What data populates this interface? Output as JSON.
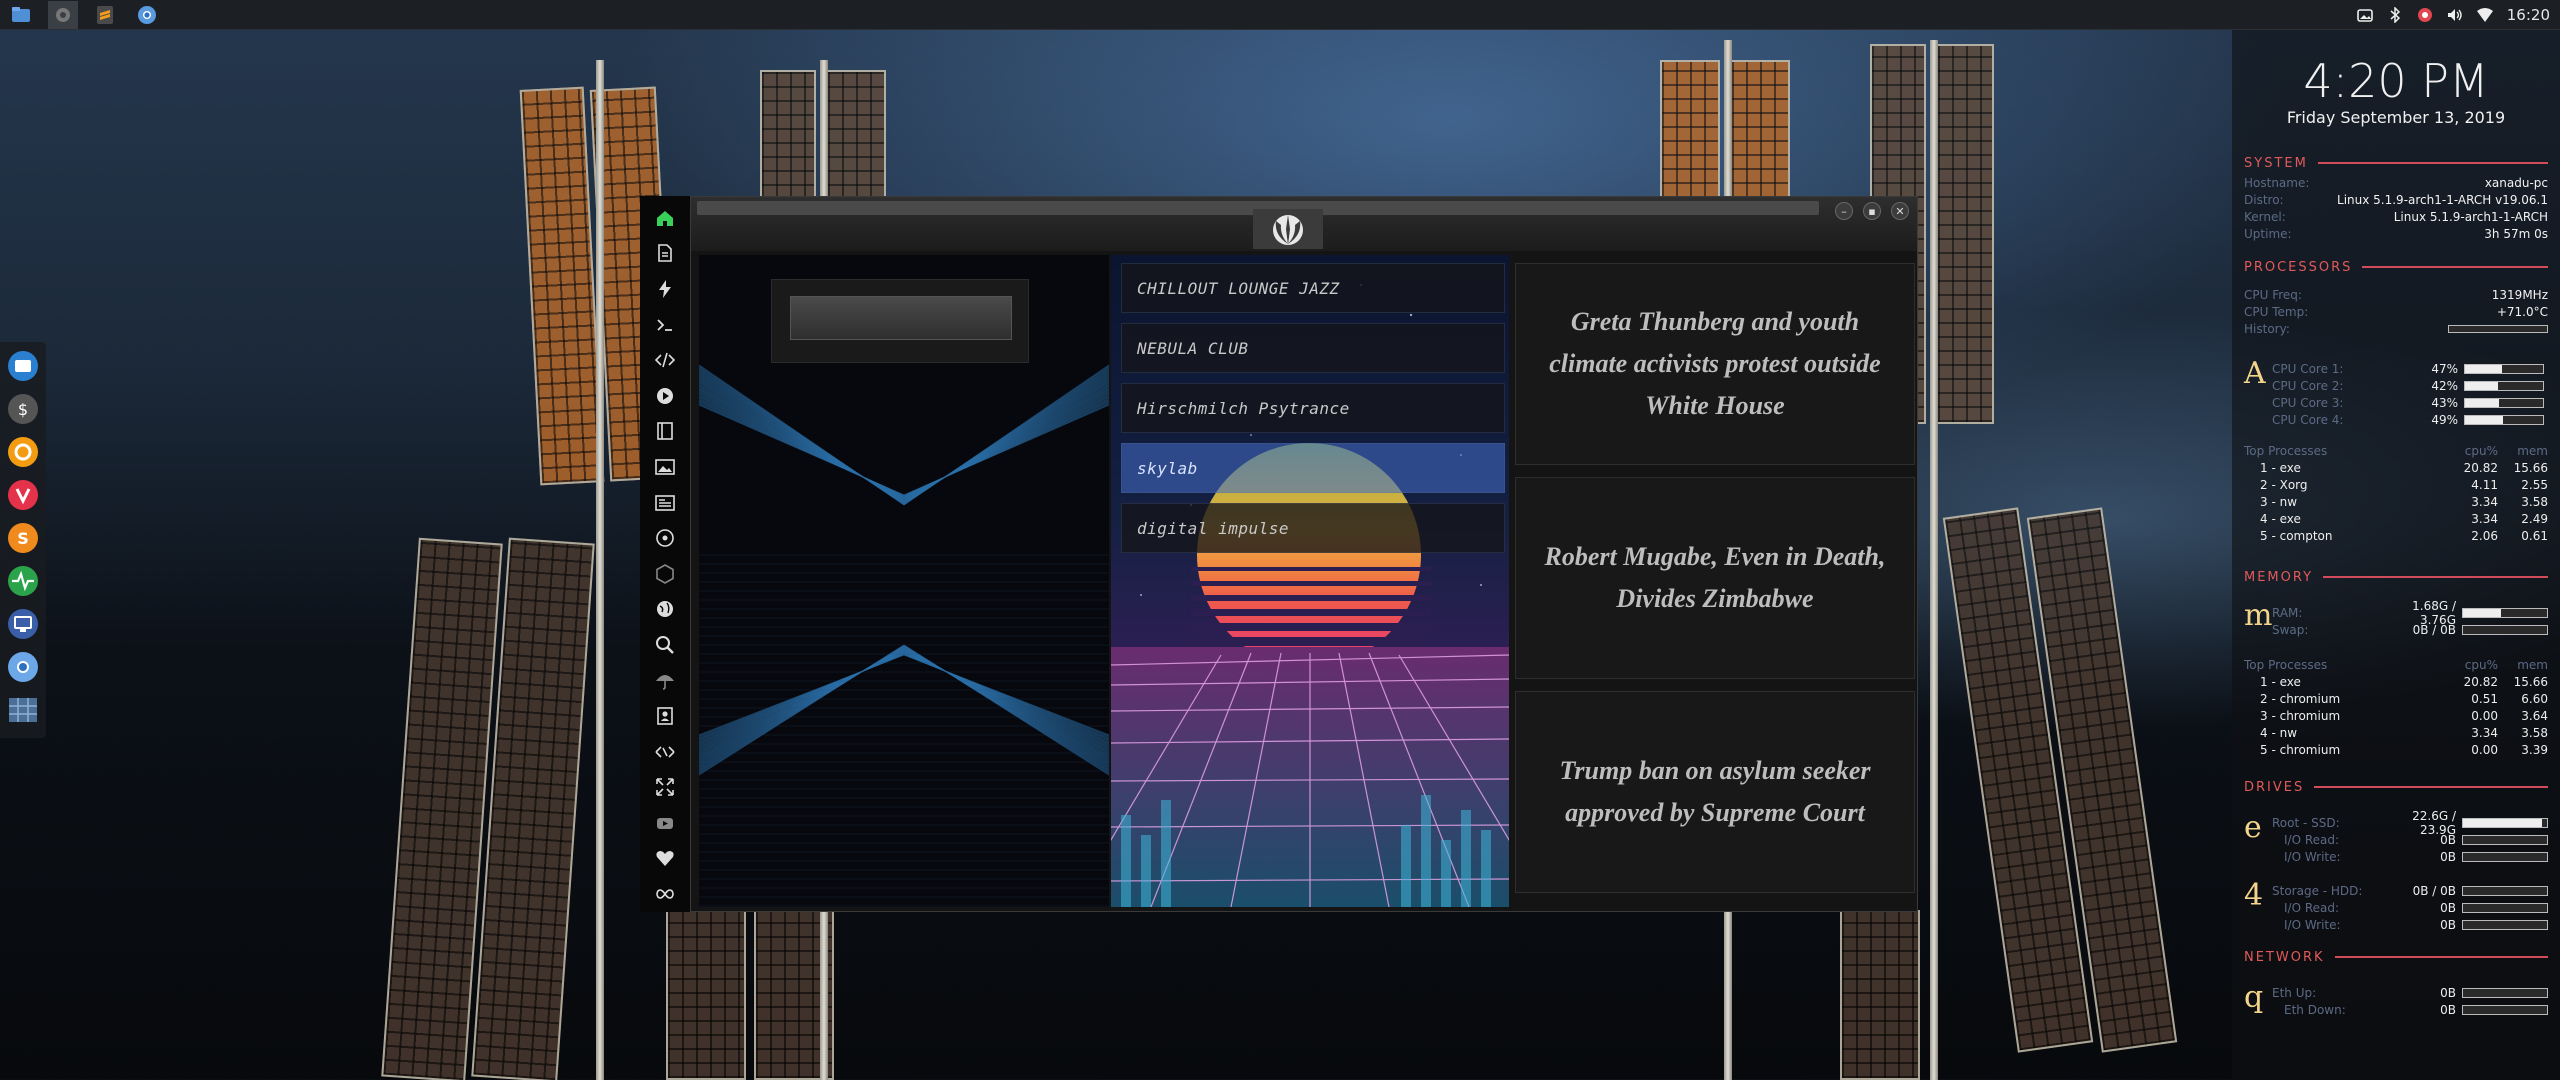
{
  "top_panel": {
    "launchers": [
      "files-icon",
      "settings-icon",
      "sublime-icon",
      "chromium-icon"
    ],
    "tray_icons": [
      "screenshot-icon",
      "bluetooth-icon",
      "bug-icon",
      "volume-icon",
      "wifi-icon"
    ],
    "clock": "16:20"
  },
  "left_dock": {
    "items": [
      "file-manager-icon",
      "money-icon",
      "ubuntu-icon",
      "vivaldi-icon",
      "stacer-icon",
      "system-monitor-icon",
      "remote-desktop-icon",
      "chromium-icon",
      "workspace-icon"
    ]
  },
  "app_sidebar": {
    "items": [
      "home-icon",
      "document-icon",
      "bolt-icon",
      "terminal-icon",
      "code-icon",
      "play-icon",
      "book-icon",
      "image-icon",
      "news-icon",
      "atom-icon",
      "hexagon-icon",
      "globe-icon",
      "search-icon",
      "umbrella-icon",
      "contact-icon",
      "shuffle-icon",
      "expand-icon",
      "youtube-icon",
      "heart-icon",
      "infinity-icon"
    ]
  },
  "window": {
    "title": "",
    "search": {
      "value": "",
      "placeholder": ""
    },
    "stations": [
      {
        "label": "CHILLOUT LOUNGE JAZZ",
        "selected": false
      },
      {
        "label": "NEBULA CLUB",
        "selected": false
      },
      {
        "label": "Hirschmilch Psytrance",
        "selected": false
      },
      {
        "label": "skylab",
        "selected": true
      },
      {
        "label": "digital impulse",
        "selected": false
      }
    ],
    "news": [
      "Greta Thunberg and youth climate activists protest outside White House",
      "Robert Mugabe, Even in Death, Divides Zimbabwe",
      "Trump ban on asylum seeker approved by Supreme Court"
    ]
  },
  "conky": {
    "time": "4:20 PM",
    "date": "Friday September 13, 2019",
    "system": {
      "heading": "SYSTEM",
      "hostname_label": "Hostname:",
      "hostname": "xanadu-pc",
      "distro_label": "Distro:",
      "distro": "Linux 5.1.9-arch1-1-ARCH v19.06.1",
      "kernel_label": "Kernel:",
      "kernel": "Linux 5.1.9-arch1-1-ARCH",
      "uptime_label": "Uptime:",
      "uptime": "3h 57m 0s"
    },
    "processors": {
      "heading": "PROCESSORS",
      "freq_label": "CPU Freq:",
      "freq": "1319MHz",
      "temp_label": "CPU Temp:",
      "temp": "+71.0°C",
      "history_label": "History:",
      "glyph": "A",
      "cores": [
        {
          "label": "CPU Core 1:",
          "value": "47%",
          "fraction": 0.47
        },
        {
          "label": "CPU Core 2:",
          "value": "42%",
          "fraction": 0.42
        },
        {
          "label": "CPU Core 3:",
          "value": "43%",
          "fraction": 0.43
        },
        {
          "label": "CPU Core 4:",
          "value": "49%",
          "fraction": 0.49
        }
      ],
      "top_label": "Top Processes",
      "cpu_col": "cpu%",
      "mem_col": "mem",
      "top": [
        {
          "name": "1 - exe",
          "cpu": "20.82",
          "mem": "15.66"
        },
        {
          "name": "2 - Xorg",
          "cpu": "4.11",
          "mem": "2.55"
        },
        {
          "name": "3 - nw",
          "cpu": "3.34",
          "mem": "3.58"
        },
        {
          "name": "4 - exe",
          "cpu": "3.34",
          "mem": "2.49"
        },
        {
          "name": "5 - compton",
          "cpu": "2.06",
          "mem": "0.61"
        }
      ]
    },
    "memory": {
      "heading": "MEMORY",
      "glyph": "m",
      "ram_label": "RAM:",
      "ram": "1.68G / 3.76G",
      "ram_fraction": 0.45,
      "swap_label": "Swap:",
      "swap": "0B / 0B",
      "swap_fraction": 0,
      "top_label": "Top Processes",
      "cpu_col": "cpu%",
      "mem_col": "mem",
      "top": [
        {
          "name": "1 - exe",
          "cpu": "20.82",
          "mem": "15.66"
        },
        {
          "name": "2 - chromium",
          "cpu": "0.51",
          "mem": "6.60"
        },
        {
          "name": "3 - chromium",
          "cpu": "0.00",
          "mem": "3.64"
        },
        {
          "name": "4 - nw",
          "cpu": "3.34",
          "mem": "3.58"
        },
        {
          "name": "5 - chromium",
          "cpu": "0.00",
          "mem": "3.39"
        }
      ]
    },
    "drives": {
      "heading": "DRIVES",
      "root_glyph": "e",
      "root_label": "Root  -  SSD:",
      "root": "22.6G / 23.9G",
      "root_fraction": 0.94,
      "root_read_label": "I/O Read:",
      "root_read": "0B",
      "root_write_label": "I/O Write:",
      "root_write": "0B",
      "storage_glyph": "4",
      "storage_label": "Storage  -  HDD:",
      "storage": "0B / 0B",
      "storage_fraction": 0,
      "storage_read_label": "I/O Read:",
      "storage_read": "0B",
      "storage_write_label": "I/O Write:",
      "storage_write": "0B"
    },
    "network": {
      "heading": "NETWORK",
      "glyph": "q",
      "up_label": "Eth Up:",
      "up": "0B",
      "down_label": "Eth Down:",
      "down": "0B"
    }
  },
  "colors": {
    "accent_red": "#d24b5a",
    "label_blue": "#5c6a86",
    "glyph_gold": "#f2d58a",
    "selected_station": "#466ec8"
  }
}
